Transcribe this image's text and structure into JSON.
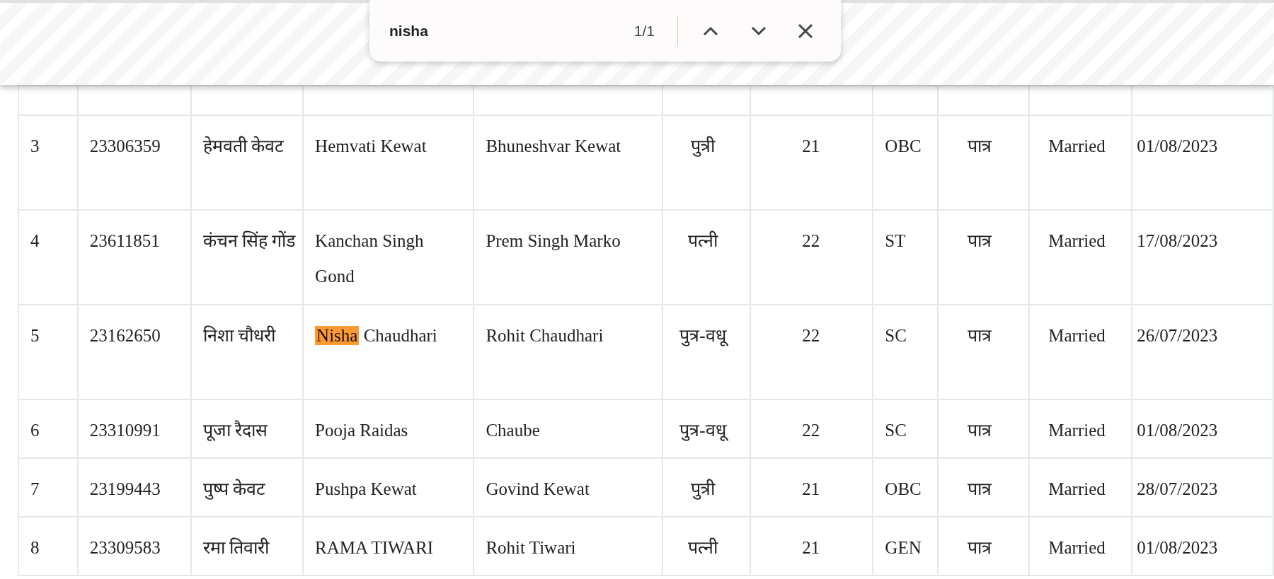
{
  "find_bar": {
    "query": "nisha",
    "count": "1/1"
  },
  "table": {
    "rows": [
      {
        "cells": [
          "3",
          "23306359",
          "हेमवती केवट",
          "Hemvati Kewat",
          "Bhuneshvar Kewat",
          "पुत्री",
          "21",
          "OBC",
          "पात्र",
          "Married",
          "01/08/2023"
        ]
      },
      {
        "cells": [
          "4",
          "23611851",
          "कंचन सिंह गोंड",
          "Kanchan Singh Gond",
          "Prem Singh Marko",
          "पत्नी",
          "22",
          "ST",
          "पात्र",
          "Married",
          "17/08/2023"
        ]
      },
      {
        "cells": [
          "5",
          "23162650",
          "निशा चौधरी",
          "Nisha Chaudhari",
          "Rohit Chaudhari",
          "पुत्र-वधू",
          "22",
          "SC",
          "पात्र",
          "Married",
          "26/07/2023"
        ]
      },
      {
        "cells": [
          "6",
          "23310991",
          "पूजा रैदास",
          "Pooja Raidas",
          "Chaube",
          "पुत्र-वधू",
          "22",
          "SC",
          "पात्र",
          "Married",
          "01/08/2023"
        ]
      },
      {
        "cells": [
          "7",
          "23199443",
          "पुष्प केवट",
          "Pushpa Kewat",
          "Govind Kewat",
          "पुत्री",
          "21",
          "OBC",
          "पात्र",
          "Married",
          "28/07/2023"
        ]
      },
      {
        "cells": [
          "8",
          "23309583",
          "रमा तिवारी",
          "RAMA TIWARI",
          "Rohit Tiwari",
          "पत्नी",
          "21",
          "GEN",
          "पात्र",
          "Married",
          "01/08/2023"
        ]
      }
    ]
  }
}
